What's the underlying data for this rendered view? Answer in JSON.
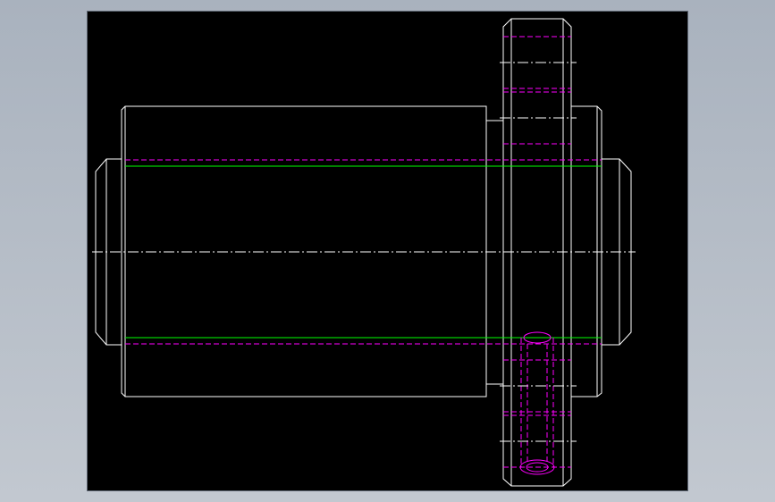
{
  "colors": {
    "background": "#a9b2be",
    "viewport": "#000000",
    "outline": "#ffffff",
    "hidden_line": "#ff00ff",
    "pitch_line": "#00ff00",
    "center_line": "#ffffff"
  },
  "drawing": {
    "view": "cad-2d-side-view",
    "parts": [
      "shaft",
      "main-body",
      "flange",
      "bolt-hole"
    ]
  }
}
